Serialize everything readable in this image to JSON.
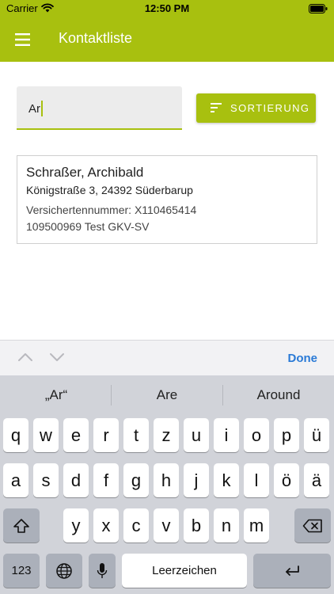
{
  "status_bar": {
    "carrier": "Carrier",
    "time": "12:50 PM"
  },
  "app_bar": {
    "title": "Kontaktliste"
  },
  "search": {
    "value": "Ar"
  },
  "sort_button": {
    "label": "SORTIERUNG"
  },
  "contact": {
    "name": "Schraßer, Archibald",
    "address": "Königstraße 3, 24392 Süderbarup",
    "insurance_number": "Versichertennummer: X110465414",
    "insurer": "109500969 Test GKV-SV"
  },
  "accessory": {
    "done": "Done"
  },
  "keyboard": {
    "suggestions": [
      "„Ar“",
      "Are",
      "Around"
    ],
    "row1": [
      "q",
      "w",
      "e",
      "r",
      "t",
      "z",
      "u",
      "i",
      "o",
      "p",
      "ü"
    ],
    "row2": [
      "a",
      "s",
      "d",
      "f",
      "g",
      "h",
      "j",
      "k",
      "l",
      "ö",
      "ä"
    ],
    "row3": [
      "y",
      "x",
      "c",
      "v",
      "b",
      "n",
      "m"
    ],
    "numbers_key": "123",
    "space_key": "Leerzeichen"
  },
  "colors": {
    "brand": "#a8c00f",
    "done": "#2a7ad6"
  }
}
